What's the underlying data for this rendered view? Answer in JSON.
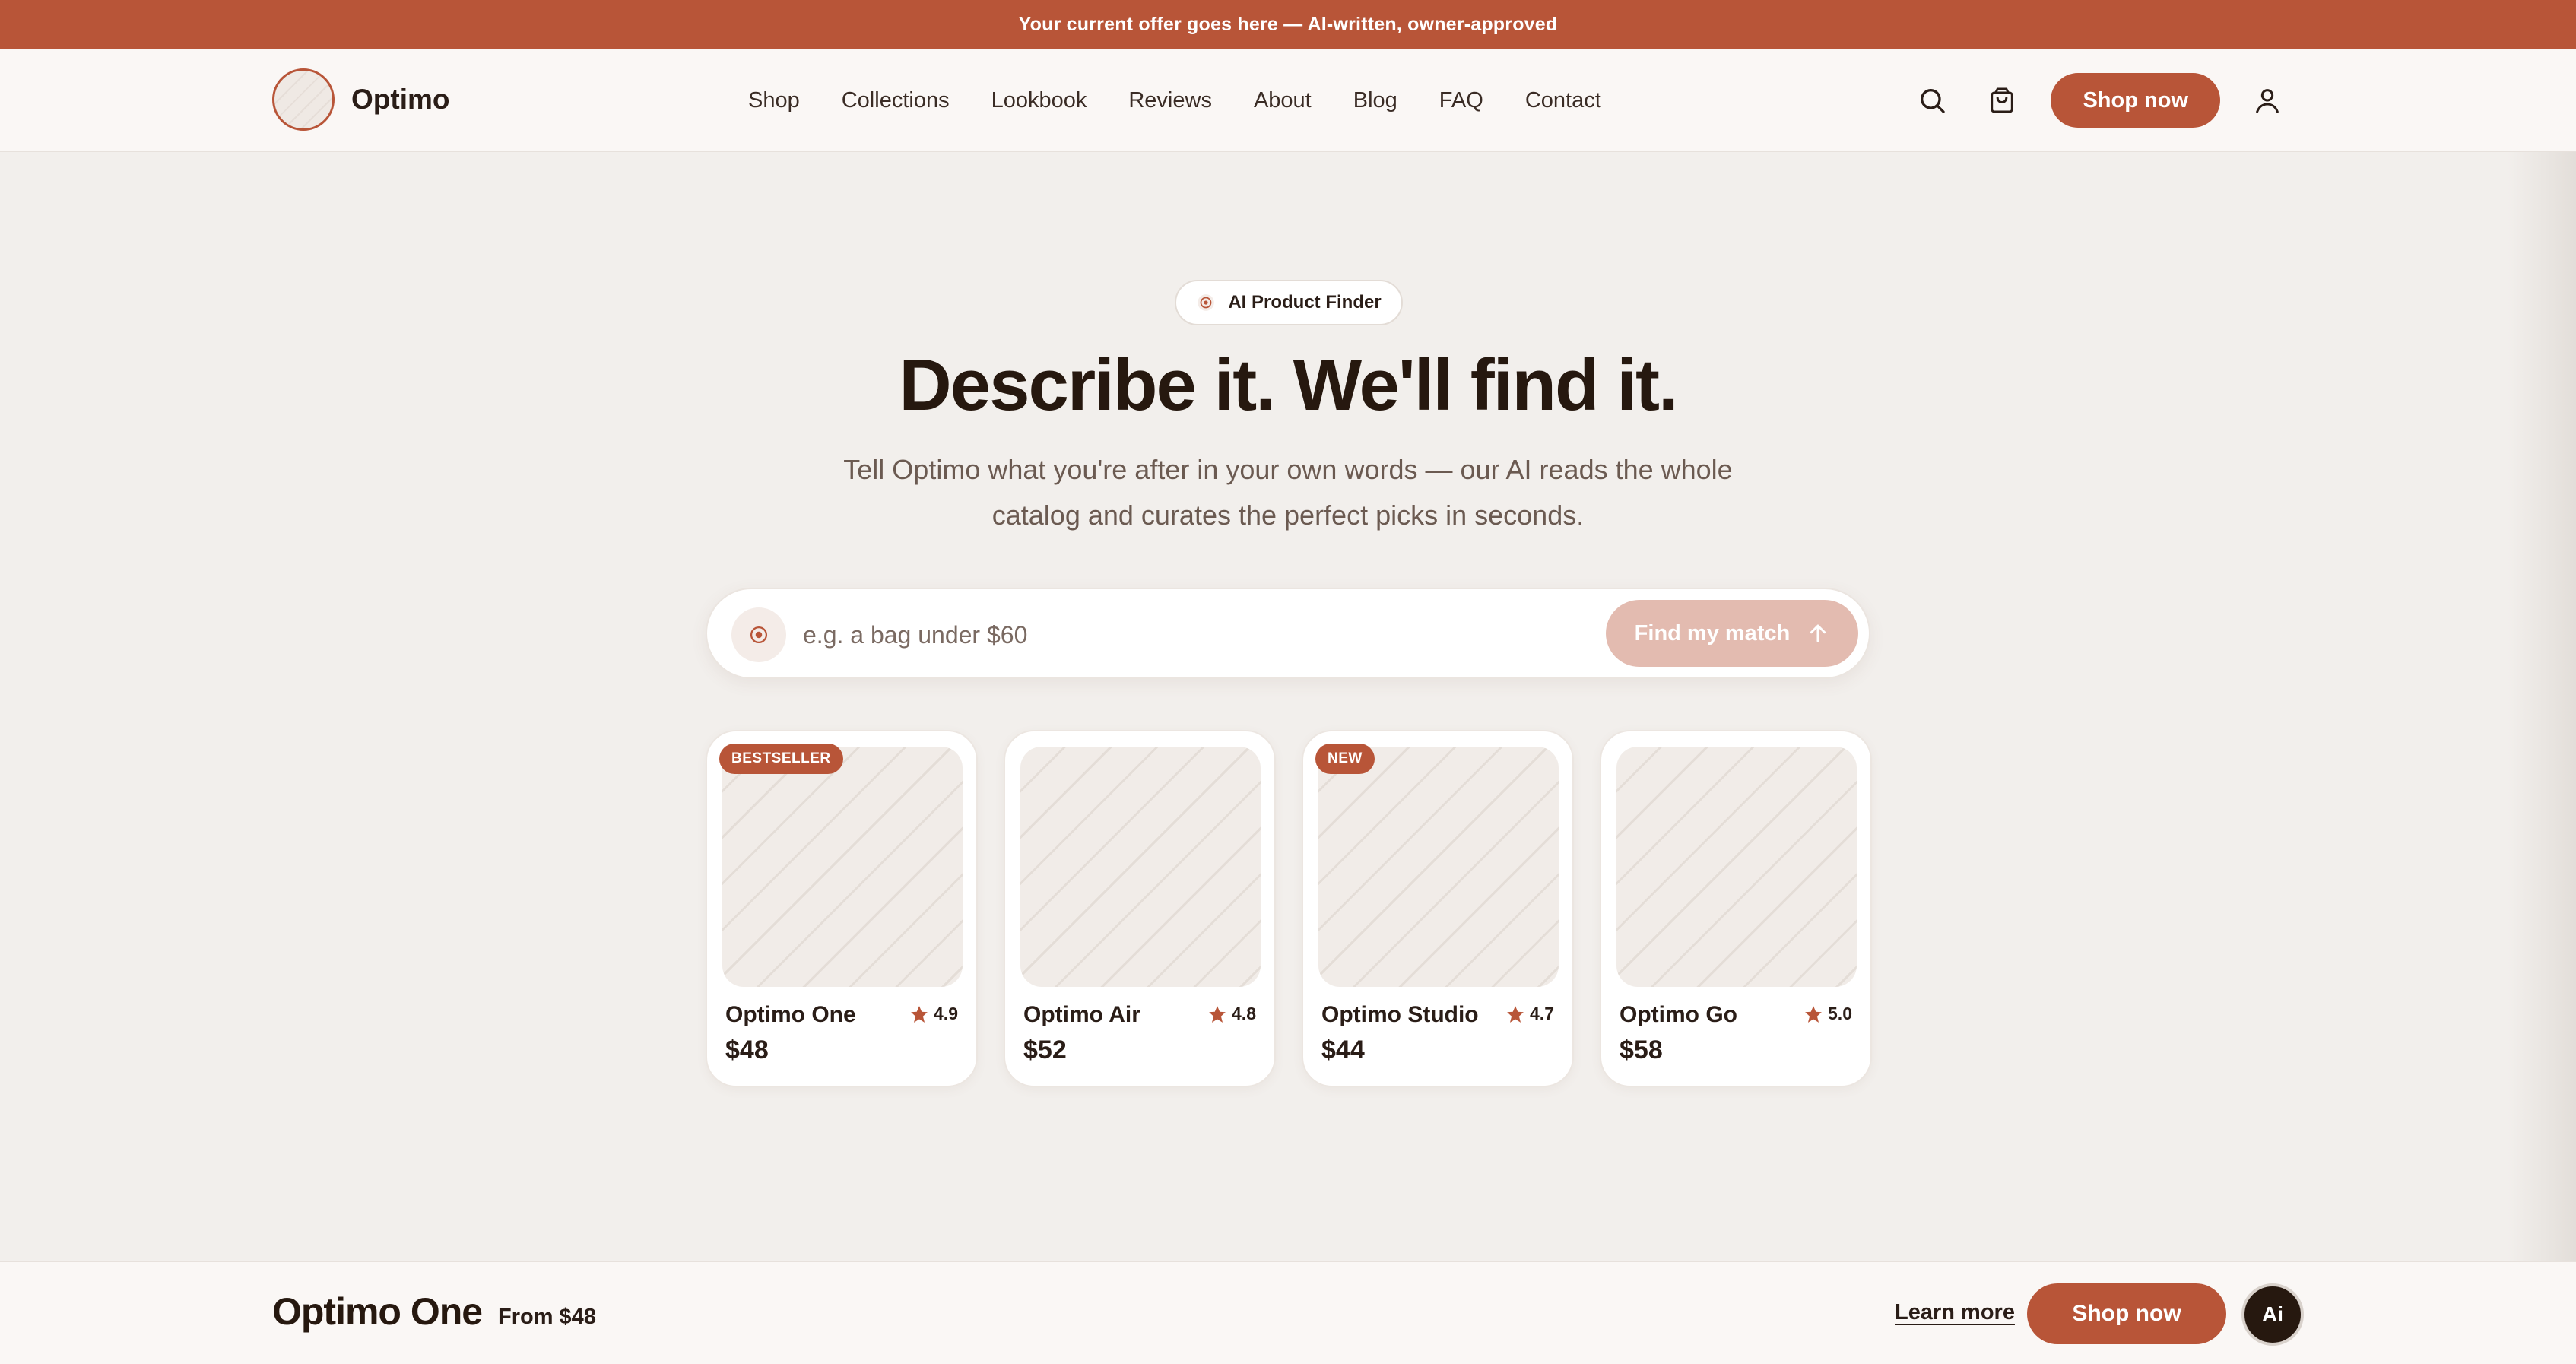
{
  "promo": {
    "text": "Your current offer goes here — AI-written, owner-approved"
  },
  "header": {
    "brand": "Optimo",
    "nav": [
      "Shop",
      "Collections",
      "Lookbook",
      "Reviews",
      "About",
      "Blog",
      "FAQ",
      "Contact"
    ],
    "shop_now": "Shop now",
    "icons": [
      "search-icon",
      "cart-icon",
      "user-icon"
    ]
  },
  "hero": {
    "chip": "AI Product Finder",
    "title": "Describe it. We'll find it.",
    "subtitle": "Tell Optimo what you're after in your own words — our AI reads the whole catalog and curates the perfect picks in seconds."
  },
  "search": {
    "placeholder": "e.g. a bag under $60",
    "value": "",
    "button": "Find my match"
  },
  "products": [
    {
      "badge": "BESTSELLER",
      "name": "Optimo One",
      "rating": "4.9",
      "price": "$48"
    },
    {
      "badge": "",
      "name": "Optimo Air",
      "rating": "4.8",
      "price": "$52"
    },
    {
      "badge": "NEW",
      "name": "Optimo Studio",
      "rating": "4.7",
      "price": "$44"
    },
    {
      "badge": "",
      "name": "Optimo Go",
      "rating": "5.0",
      "price": "$58"
    }
  ],
  "sticky": {
    "name": "Optimo One",
    "price": "From $48",
    "learn_more": "Learn more",
    "shop_now": "Shop now",
    "ai": "Ai"
  },
  "colors": {
    "accent": "#b85538",
    "accent_light": "#e3bbb0",
    "background": "#f2efec",
    "text_dark": "#26180f"
  }
}
